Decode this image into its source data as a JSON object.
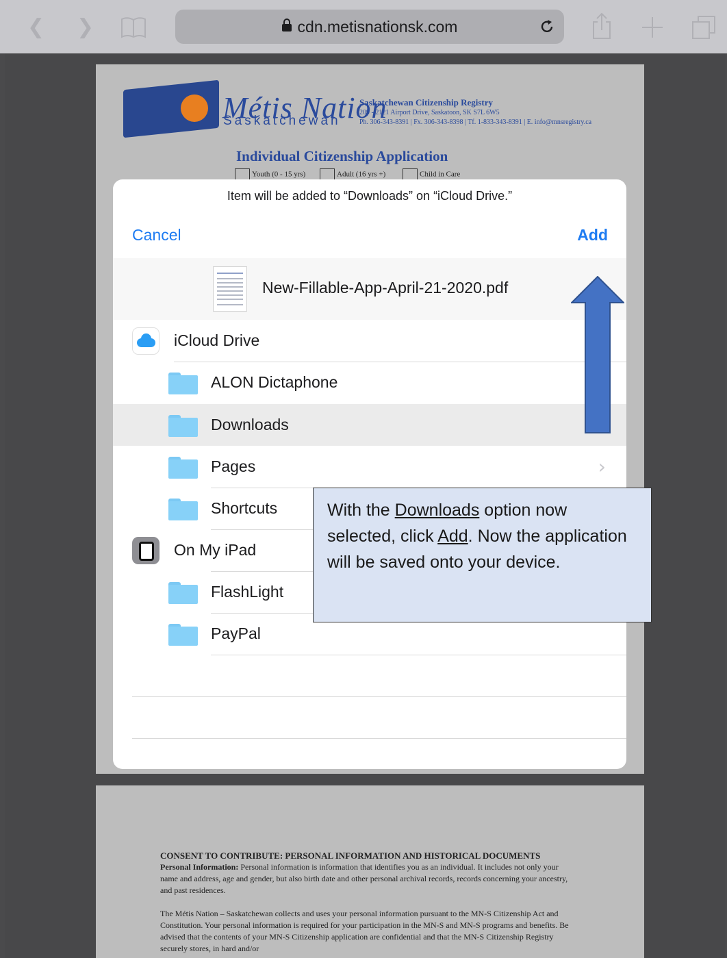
{
  "browser": {
    "url": "cdn.metisnationsk.com",
    "icons": [
      "back-icon",
      "forward-icon",
      "bookmarks-icon",
      "reload-icon",
      "share-icon",
      "new-tab-icon",
      "tabs-icon"
    ]
  },
  "pdf": {
    "org_name": "Métis Nation",
    "org_sub": "Saskatchewan",
    "registry_title": "Saskatchewan Citizenship Registry",
    "registry_address": "209 - 2121 Airport Drive, Saskatoon, SK S7L 6W5",
    "registry_contact": "Ph. 306-343-8391 | Fx. 306-343-8398 | Tf. 1-833-343-8391 | E. info@mnsregistry.ca",
    "form_title": "Individual Citizenship Application",
    "checkbox_youth": "Youth (0 - 15 yrs)",
    "checkbox_adult": "Adult (16 yrs +)",
    "checkbox_care": "Child in Care",
    "consent_title": "CONSENT TO CONTRIBUTE: PERSONAL INFORMATION AND HISTORICAL DOCUMENTS",
    "consent_p1_lead": "Personal Information:",
    "consent_p1": " Personal information is information that identifies you as an individual. It includes not only your name and address, age and gender, but also birth date and other personal archival records, records concerning your ancestry, and past residences.",
    "consent_p2": "The Métis Nation – Saskatchewan collects and uses your personal information pursuant to the MN-S Citizenship Act and Constitution. Your personal information is required for your participation in the MN-S and MN-S programs and benefits. Be advised that the contents of your MN-S Citizenship application are confidential and that the MN-S Citizenship Registry securely stores, in hard and/or"
  },
  "sheet": {
    "message": "Item will be added to “Downloads” on “iCloud Drive.”",
    "cancel_label": "Cancel",
    "add_label": "Add",
    "filename": "New-Fillable-App-April-21-2020.pdf",
    "locations": [
      {
        "label": "iCloud Drive"
      },
      {
        "label": "ALON Dictaphone"
      },
      {
        "label": "Downloads"
      },
      {
        "label": "Pages"
      },
      {
        "label": "Shortcuts"
      },
      {
        "label": "On My iPad"
      },
      {
        "label": "FlashLight"
      },
      {
        "label": "PayPal"
      }
    ]
  },
  "annotation": {
    "t1": "With the ",
    "u1": "Downloads",
    "t2": " option now selected, click ",
    "u2": "Add",
    "t3": ". Now the application will be saved onto your device."
  },
  "colors": {
    "accent": "#1e7cf2",
    "arrow_fill": "#4472c4",
    "arrow_stroke": "#2f528f",
    "callout_bg": "#dae3f3"
  }
}
